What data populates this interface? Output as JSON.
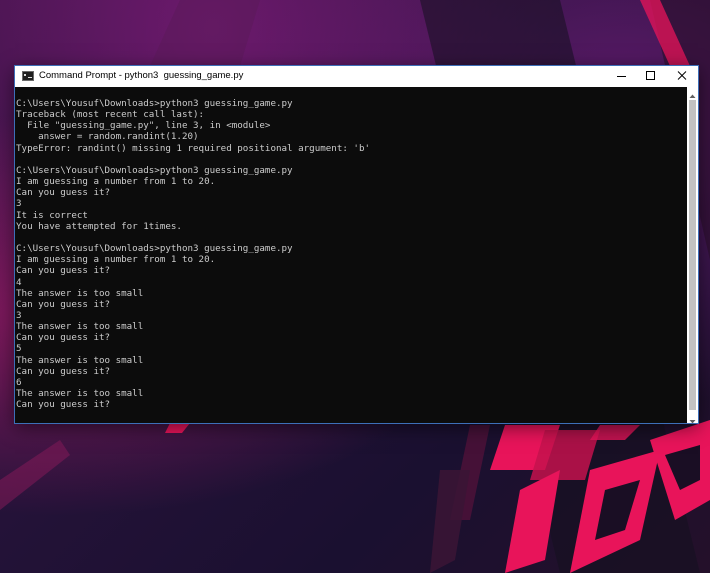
{
  "window": {
    "title": "Command Prompt - python3  guessing_game.py",
    "app_icon": "command-prompt-icon",
    "controls": {
      "minimize_icon": "minimize-icon",
      "maximize_icon": "maximize-icon",
      "close_icon": "close-icon"
    }
  },
  "console": {
    "text": "C:\\Users\\Yousuf\\Downloads>python3 guessing_game.py\nTraceback (most recent call last):\n  File \"guessing_game.py\", line 3, in <module>\n    answer = random.randint(1.20)\nTypeError: randint() missing 1 required positional argument: 'b'\n\nC:\\Users\\Yousuf\\Downloads>python3 guessing_game.py\nI am guessing a number from 1 to 20.\nCan you guess it?\n3\nIt is correct\nYou have attempted for 1times.\n\nC:\\Users\\Yousuf\\Downloads>python3 guessing_game.py\nI am guessing a number from 1 to 20.\nCan you guess it?\n4\nThe answer is too small\nCan you guess it?\n3\nThe answer is too small\nCan you guess it?\n5\nThe answer is too small\nCan you guess it?\n6\nThe answer is too small\nCan you guess it?",
    "background": "#0c0c0c",
    "foreground": "#cccccc"
  },
  "colors": {
    "accent_pink": "#e8145a",
    "window_border": "#3d6fb8"
  }
}
